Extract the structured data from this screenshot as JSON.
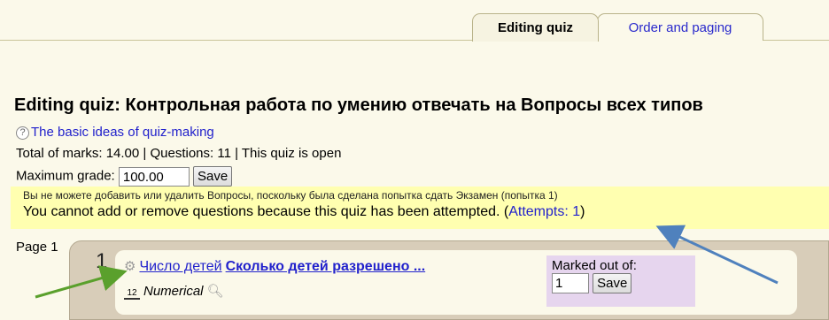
{
  "tabs": [
    {
      "label": "Editing quiz",
      "active": true
    },
    {
      "label": "Order and paging",
      "active": false
    }
  ],
  "page_title": "Editing quiz: Контрольная работа по умению отвечать на Вопросы всех типов",
  "help_link": "The basic ideas of quiz-making",
  "summary": "Total of marks: 14.00 | Questions: 11 | This quiz is open",
  "max_grade": {
    "label": "Maximum grade:",
    "value": "100.00",
    "save_label": "Save"
  },
  "warning": {
    "ru": "Вы не можете добавить или удалить Вопросы, поскольку была сделана попытка сдать Экзамен (попытка 1)",
    "en": "You cannot add or remove questions because this quiz has been attempted. (",
    "attempts_link": "Attempts: 1",
    "close_paren": ")"
  },
  "page": {
    "label": "Page 1"
  },
  "question": {
    "number": "1",
    "name": "Число детей",
    "text": "Сколько детей разрешено ...",
    "type": "Numerical",
    "type_icon_text": "12",
    "marked_label": "Marked out of:",
    "mark_value": "1",
    "save_label": "Save"
  },
  "colors": {
    "background": "#fbf9ea",
    "link": "#2222cc",
    "warning_bg": "#ffffb0",
    "page_box": "#d8cdb9",
    "marked_bg": "#e6d5ee",
    "arrow_green": "#5aa02c",
    "arrow_blue": "#4f81bd"
  }
}
